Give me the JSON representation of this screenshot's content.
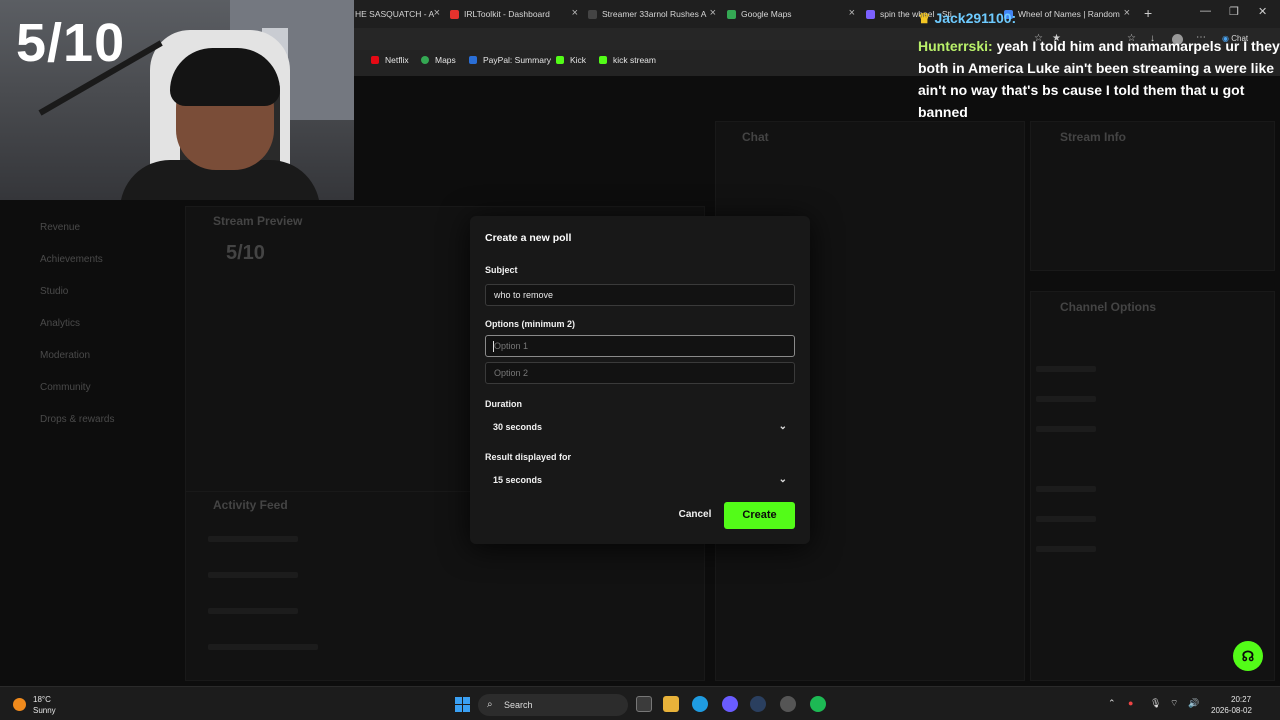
{
  "browser": {
    "tabs": [
      {
        "label": "HE SASQUATCH - A",
        "color": "#888888"
      },
      {
        "label": "IRLToolkit - Dashboard",
        "color": "#e5322d"
      },
      {
        "label": "Streamer 33arnol Rushes A",
        "color": "#222222"
      },
      {
        "label": "Google Maps",
        "color": "#34a853"
      },
      {
        "label": "spin the wheel - Sti",
        "color": "#7b61ff"
      },
      {
        "label": "Wheel of Names | Random",
        "color": "#4285f4"
      }
    ],
    "new_tab": "+",
    "bookmarks": [
      {
        "label": "Netflix",
        "color": "#e50914"
      },
      {
        "label": "Maps",
        "color": "#34a853"
      },
      {
        "label": "PayPal: Summary",
        "color": "#2a6ed6"
      },
      {
        "label": "Kick",
        "color": "#53fc18"
      },
      {
        "label": "kick stream",
        "color": "#53fc18"
      }
    ],
    "chat_button": "Chat"
  },
  "stream": {
    "counter": "5/10",
    "chat_overlay": {
      "username": "Jack291100:",
      "message_name": "Hunterrski:",
      "message_text": "yeah I told him and mamamarpels ur I they both in America Luke ain't been streaming a were like ain't no way that's bs cause I told them that u got banned"
    }
  },
  "background": {
    "sidebar": [
      "Revenue",
      "Achievements",
      "Studio",
      "Analytics",
      "Moderation",
      "Community",
      "Drops & rewards"
    ],
    "stream_preview": "Stream Preview",
    "preview_counter": "5/10",
    "activity_feed": "Activity Feed",
    "chat_title": "Chat",
    "stream_info": "Stream Info",
    "channel_options": "Channel Options"
  },
  "dialog": {
    "title": "Create a new poll",
    "subject_label": "Subject",
    "subject_value": "who to remove",
    "options_label": "Options (minimum 2)",
    "option1_placeholder": "Option 1",
    "option2_placeholder": "Option 2",
    "duration_label": "Duration",
    "duration_value": "30 seconds",
    "result_label": "Result displayed for",
    "result_value": "15 seconds",
    "cancel_label": "Cancel",
    "create_label": "Create",
    "accent": "#53fc18"
  },
  "taskbar": {
    "temperature": "18°C",
    "weather": "Sunny",
    "search": "Search",
    "time": "20:27",
    "date": "2026-08-02"
  }
}
